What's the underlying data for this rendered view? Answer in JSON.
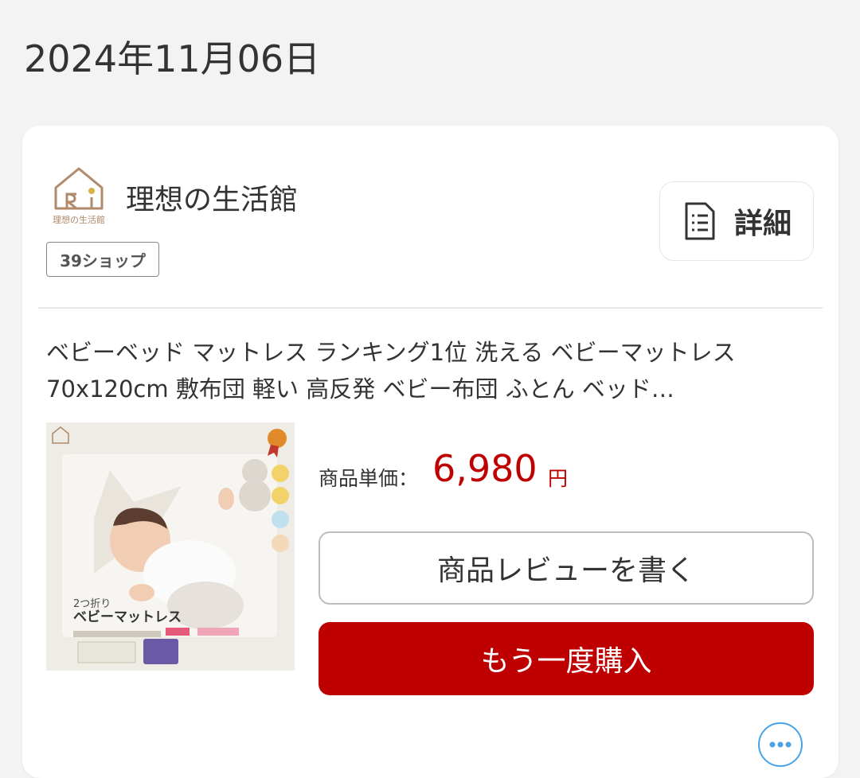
{
  "order_date": "2024年11月06日",
  "shop": {
    "logo_text": "理想の生活館",
    "name": "理想の生活館",
    "badge": "39ショップ"
  },
  "detail_button": {
    "label": "詳細"
  },
  "product": {
    "title": "ベビーベッド マットレス ランキング1位 洗える ベビーマットレス 70x120cm 敷布団 軽い 高反発 ベビー布団 ふとん ベッド…",
    "image_text_1": "2つ折り",
    "image_text_2": "ベビーマットレス",
    "price_label": "商品単価：",
    "price": "6,980",
    "price_unit": "円"
  },
  "actions": {
    "review_label": "商品レビューを書く",
    "rebuy_label": "もう一度購入"
  },
  "colors": {
    "accent_red": "#bf0000",
    "more_button_blue": "#49a3e6"
  },
  "icons": {
    "detail": "document-list-icon",
    "more": "more-horizontal-icon",
    "logo": "house-logo-icon"
  }
}
